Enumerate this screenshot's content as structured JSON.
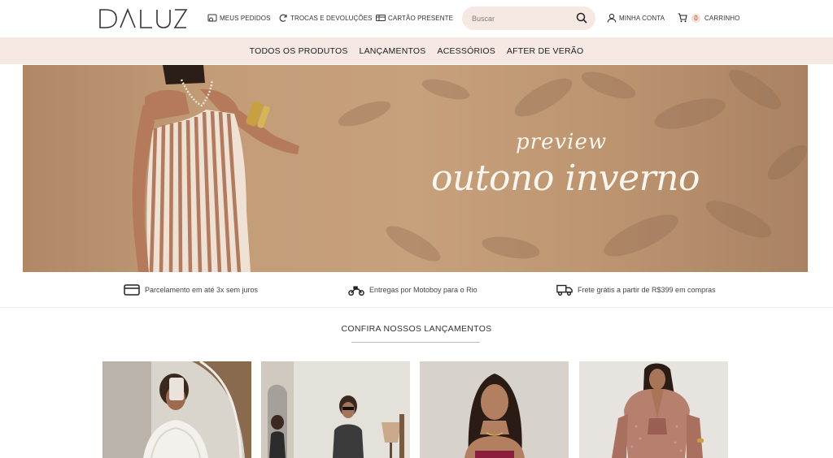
{
  "brand": {
    "logo_text": "DALUZ"
  },
  "header": {
    "links": [
      {
        "label": "MEUS PEDIDOS",
        "icon": "orders-icon"
      },
      {
        "label": "TROCAS E DEVOLUÇÕES",
        "icon": "refresh-icon"
      },
      {
        "label": "CARTÃO PRESENTE",
        "icon": "gift-card-icon"
      }
    ],
    "search": {
      "placeholder": "Buscar",
      "value": "",
      "icon": "search-icon"
    },
    "account": {
      "label": "MINHA CONTA",
      "icon": "user-icon"
    },
    "cart": {
      "label": "CARRINHO",
      "count": "0",
      "icon": "cart-icon"
    }
  },
  "nav": {
    "items": [
      {
        "label": "TODOS OS PRODUTOS"
      },
      {
        "label": "LANÇAMENTOS"
      },
      {
        "label": "ACESSÓRIOS"
      },
      {
        "label": "AFTER DE VERÃO"
      }
    ]
  },
  "hero": {
    "subtitle": "preview",
    "title": "outono inverno"
  },
  "benefits": [
    {
      "text": "Parcelamento em até 3x sem juros",
      "icon": "credit-card-icon"
    },
    {
      "text": "Entregas por Motoboy para o Rio",
      "icon": "motorcycle-icon"
    },
    {
      "text": "Frete grátis a partir de R$399 em compras",
      "icon": "truck-icon"
    }
  ],
  "section": {
    "title": "CONFIRA NOSSOS LANÇAMENTOS"
  },
  "colors": {
    "nav_bg": "#f6e8e2",
    "search_bg": "#f6e8e2",
    "hero_bg": "#c39c78",
    "hero_text": "#fdf6ee"
  }
}
